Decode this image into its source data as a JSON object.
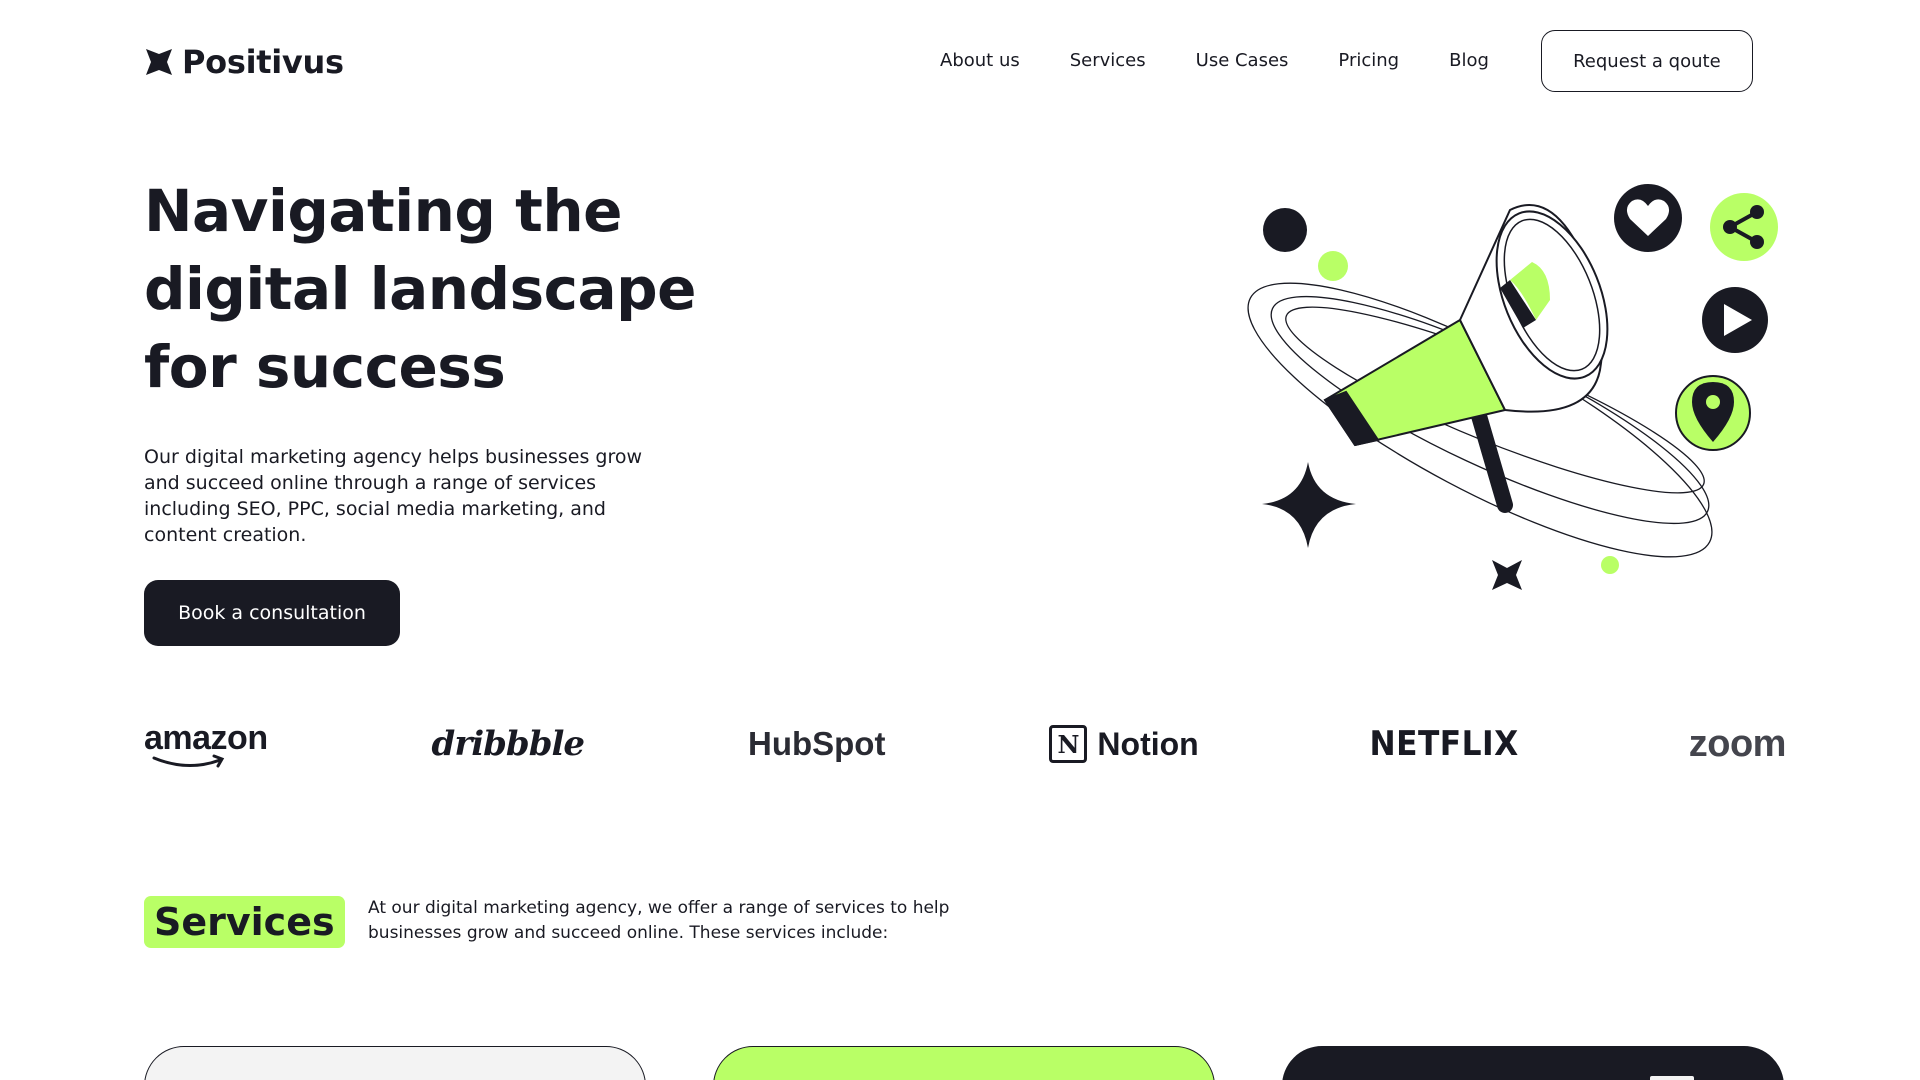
{
  "header": {
    "logo_text": "Positivus",
    "nav": [
      "About us",
      "Services",
      "Use Cases",
      "Pricing",
      "Blog"
    ],
    "cta_label": "Request a qoute"
  },
  "hero": {
    "title": "Navigating the digital landscape for success",
    "description": "Our digital marketing agency helps businesses grow and succeed online through a range of services including SEO, PPC, social media marketing, and content creation.",
    "cta_label": "Book a consultation"
  },
  "brands": {
    "amazon": "amazon",
    "dribbble": "dribbble",
    "hubspot": "HubSpot",
    "notion": "Notion",
    "notion_mark": "N",
    "netflix": "NETFLIX",
    "zoom": "zoom"
  },
  "services": {
    "heading": "Services",
    "description": "At our digital marketing agency, we offer a range of services to help businesses grow and succeed online. These services include:"
  },
  "colors": {
    "accent_green": "#b9ff66",
    "dark": "#191a23",
    "light_gray": "#f3f3f3",
    "background": "#ffffff"
  },
  "icons": [
    "positivus-logo-icon",
    "heart-icon",
    "share-icon",
    "play-icon",
    "location-pin-icon",
    "megaphone-icon",
    "sparkle-star-icon"
  ]
}
